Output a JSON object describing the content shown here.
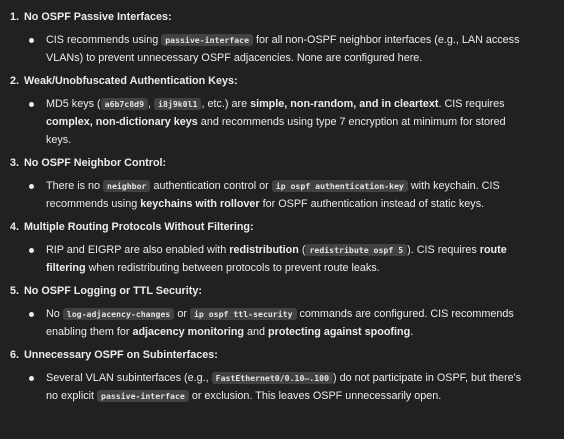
{
  "findings": [
    {
      "number": "1.",
      "title": "No OSPF Passive Interfaces:",
      "segments": [
        {
          "t": "CIS recommends using "
        },
        {
          "c": "passive-interface"
        },
        {
          "t": " for all non-OSPF neighbor interfaces (e.g., LAN access VLANs) to prevent unnecessary OSPF adjacencies. None are configured here."
        }
      ]
    },
    {
      "number": "2.",
      "title": "Weak/Unobfuscated Authentication Keys:",
      "segments": [
        {
          "t": "MD5 keys ("
        },
        {
          "c": "a6b7c8d9"
        },
        {
          "t": ", "
        },
        {
          "c": "i8j9k0l1"
        },
        {
          "t": ", etc.) are "
        },
        {
          "b": "simple, non-random, and in cleartext"
        },
        {
          "t": ". CIS requires "
        },
        {
          "b": "complex, non-dictionary keys"
        },
        {
          "t": " and recommends using type 7 encryption at minimum for stored keys."
        }
      ]
    },
    {
      "number": "3.",
      "title": "No OSPF Neighbor Control:",
      "segments": [
        {
          "t": "There is no "
        },
        {
          "c": "neighbor"
        },
        {
          "t": " authentication control or "
        },
        {
          "c": "ip ospf authentication-key"
        },
        {
          "t": " with keychain. CIS recommends using "
        },
        {
          "b": "keychains with rollover"
        },
        {
          "t": " for OSPF authentication instead of static keys."
        }
      ]
    },
    {
      "number": "4.",
      "title": "Multiple Routing Protocols Without Filtering:",
      "segments": [
        {
          "t": "RIP and EIGRP are also enabled with "
        },
        {
          "b": "redistribution"
        },
        {
          "t": " ("
        },
        {
          "c": "redistribute ospf 5"
        },
        {
          "t": "). CIS requires "
        },
        {
          "b": "route filtering"
        },
        {
          "t": " when redistributing between protocols to prevent route leaks."
        }
      ]
    },
    {
      "number": "5.",
      "title": "No OSPF Logging or TTL Security:",
      "segments": [
        {
          "t": "No "
        },
        {
          "c": "log-adjacency-changes"
        },
        {
          "t": " or "
        },
        {
          "c": "ip ospf ttl-security"
        },
        {
          "t": " commands are configured. CIS recommends enabling them for "
        },
        {
          "b": "adjacency monitoring"
        },
        {
          "t": " and "
        },
        {
          "b": "protecting against spoofing"
        },
        {
          "t": "."
        }
      ]
    },
    {
      "number": "6.",
      "title": "Unnecessary OSPF on Subinterfaces:",
      "segments": [
        {
          "t": "Several VLAN subinterfaces (e.g., "
        },
        {
          "c": "FastEthernet0/0.10–.100"
        },
        {
          "t": ") do not participate in OSPF, but there's no explicit "
        },
        {
          "c": "passive-interface"
        },
        {
          "t": " or exclusion. This leaves OSPF unnecessarily open."
        }
      ]
    }
  ]
}
